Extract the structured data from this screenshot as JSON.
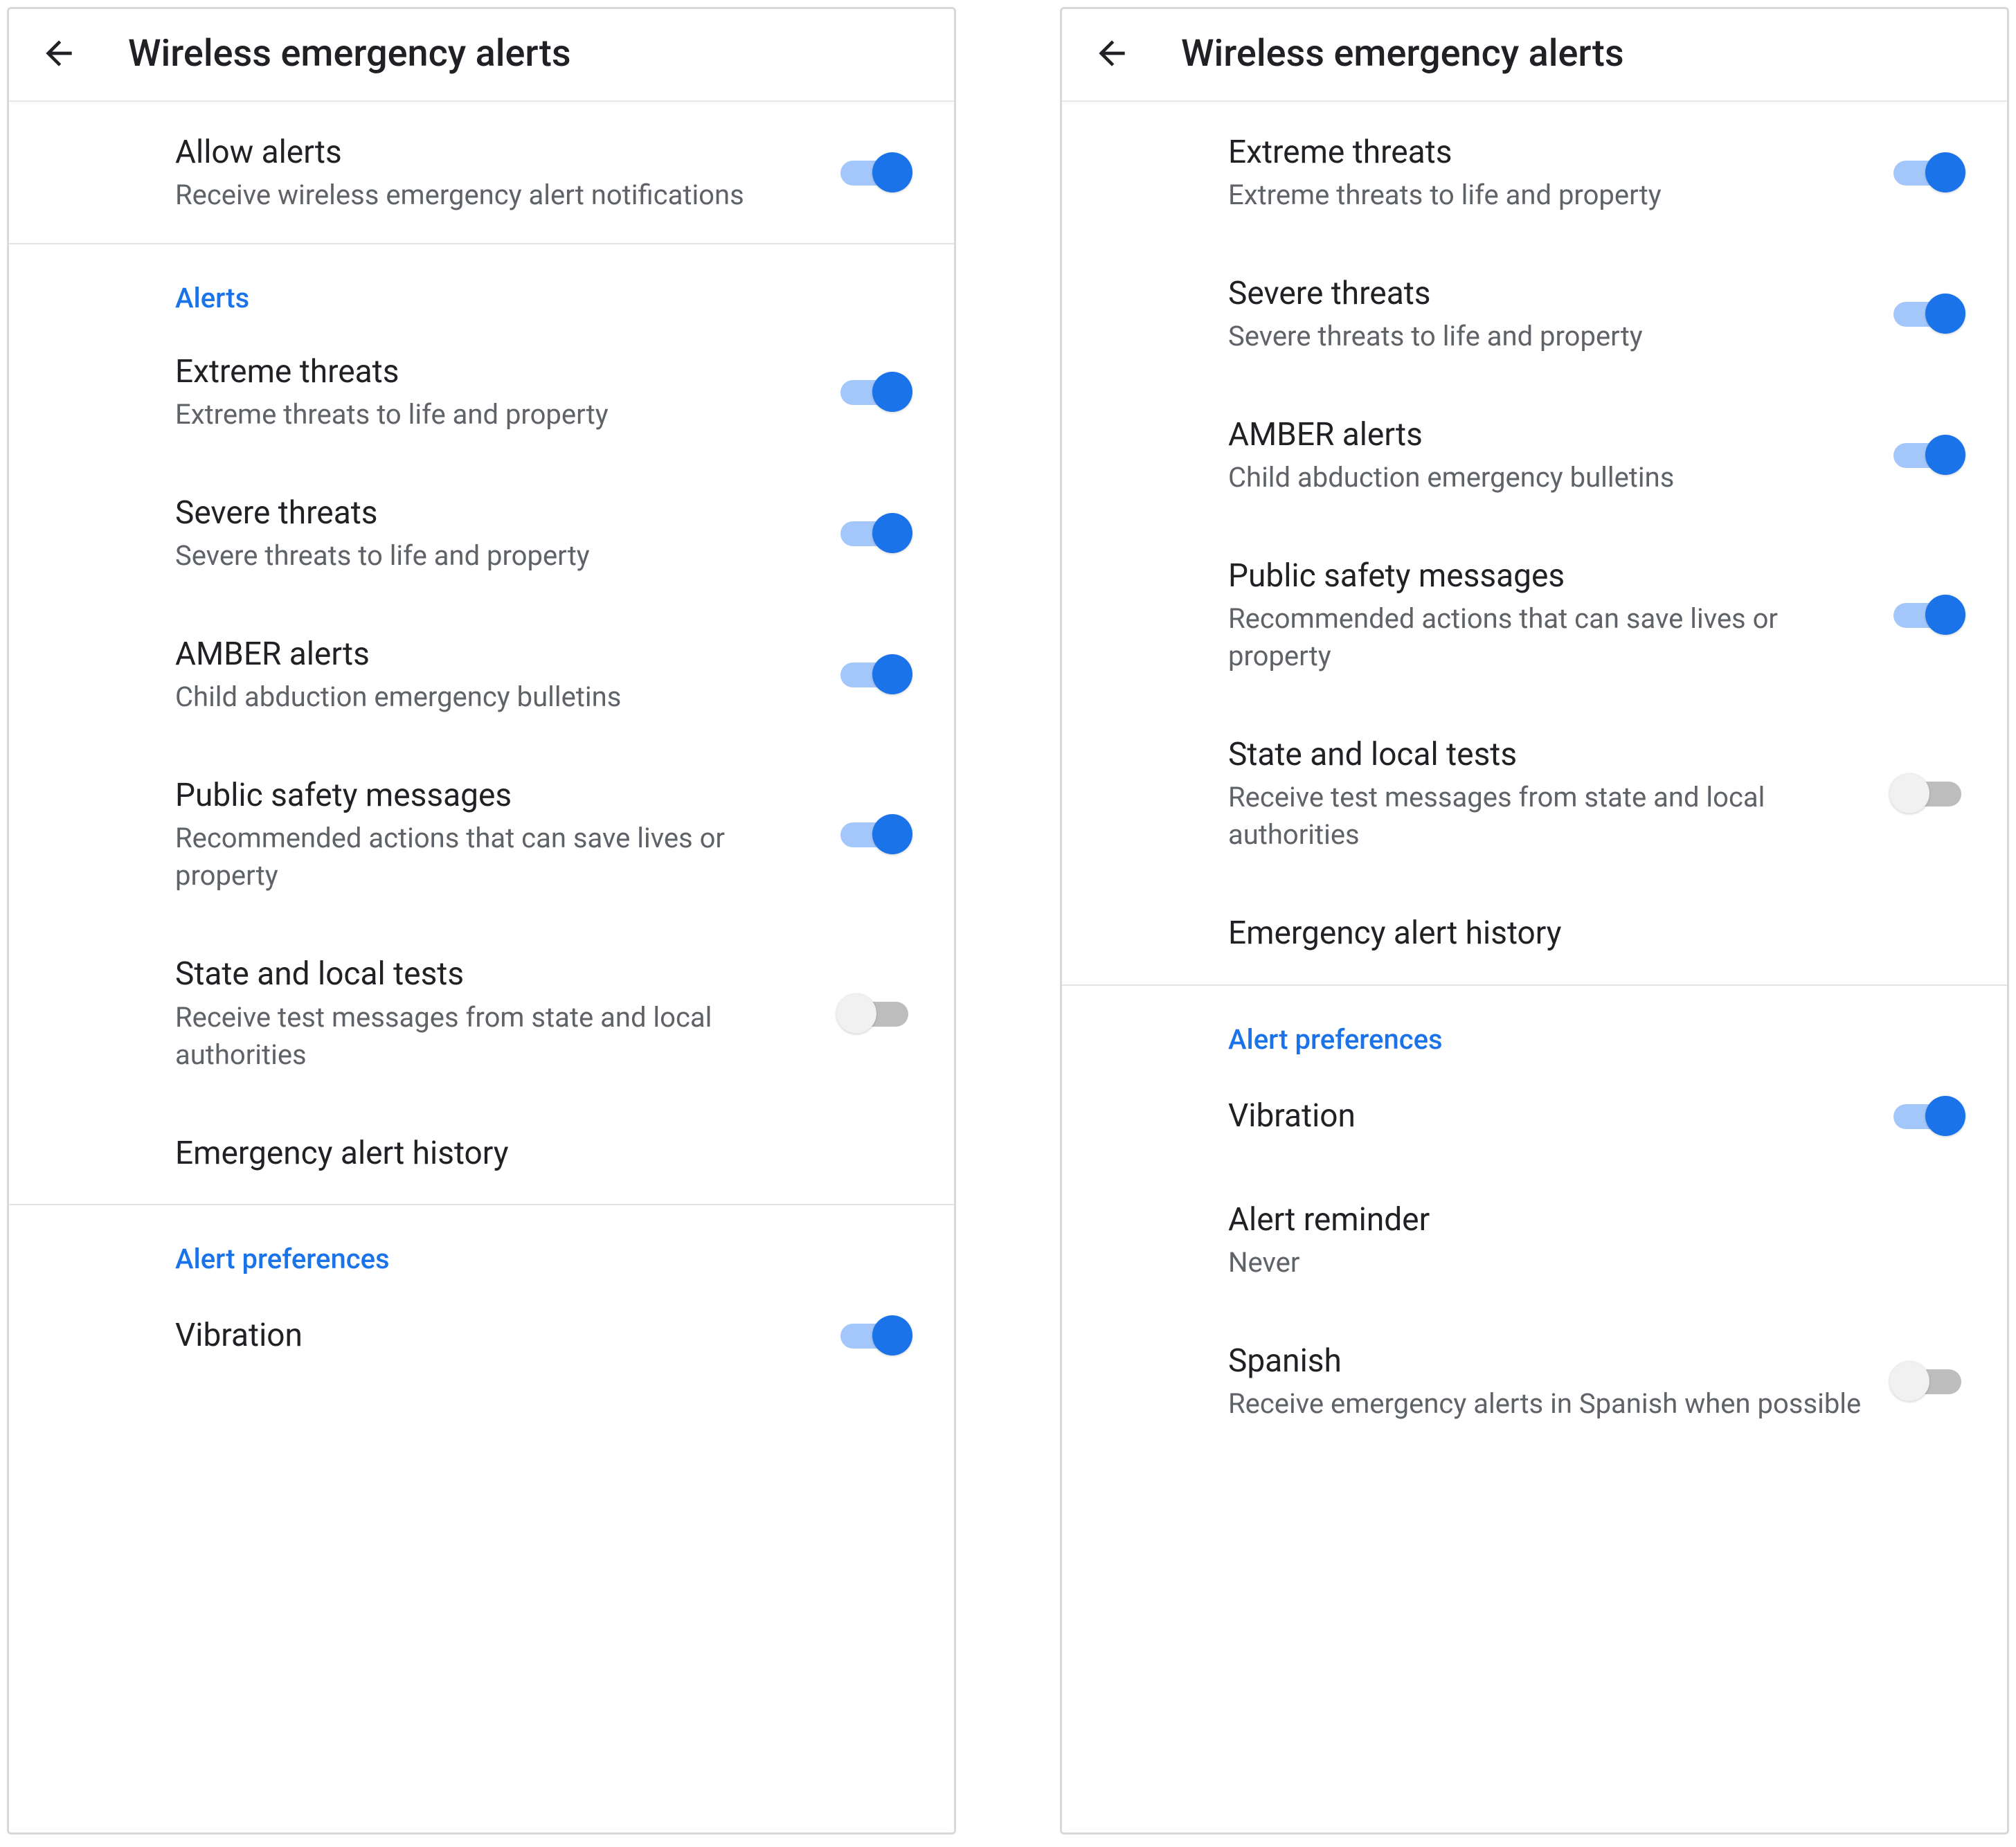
{
  "left": {
    "appbar": {
      "title": "Wireless emergency alerts"
    },
    "allow": {
      "title": "Allow alerts",
      "sub": "Receive wireless emergency alert notifications",
      "on": true
    },
    "alerts_header": "Alerts",
    "extreme": {
      "title": "Extreme threats",
      "sub": "Extreme threats to life and property",
      "on": true
    },
    "severe": {
      "title": "Severe threats",
      "sub": "Severe threats to life and property",
      "on": true
    },
    "amber": {
      "title": "AMBER alerts",
      "sub": "Child abduction emergency bulletins",
      "on": true
    },
    "public": {
      "title": "Public safety messages",
      "sub": "Recommended actions that can save lives or property",
      "on": true
    },
    "state": {
      "title": "State and local tests",
      "sub": "Receive test messages from state and local authorities",
      "on": false
    },
    "history": {
      "title": "Emergency alert history"
    },
    "prefs_header": "Alert preferences",
    "vibration": {
      "title": "Vibration",
      "on": true
    }
  },
  "right": {
    "appbar": {
      "title": "Wireless emergency alerts"
    },
    "extreme": {
      "title": "Extreme threats",
      "sub": "Extreme threats to life and property",
      "on": true
    },
    "severe": {
      "title": "Severe threats",
      "sub": "Severe threats to life and property",
      "on": true
    },
    "amber": {
      "title": "AMBER alerts",
      "sub": "Child abduction emergency bulletins",
      "on": true
    },
    "public": {
      "title": "Public safety messages",
      "sub": "Recommended actions that can save lives or property",
      "on": true
    },
    "state": {
      "title": "State and local tests",
      "sub": "Receive test messages from state and local authorities",
      "on": false
    },
    "history": {
      "title": "Emergency alert history"
    },
    "prefs_header": "Alert preferences",
    "vibration": {
      "title": "Vibration",
      "on": true
    },
    "reminder": {
      "title": "Alert reminder",
      "sub": "Never"
    },
    "spanish": {
      "title": "Spanish",
      "sub": "Receive emergency alerts in Spanish when possible",
      "on": false
    }
  }
}
